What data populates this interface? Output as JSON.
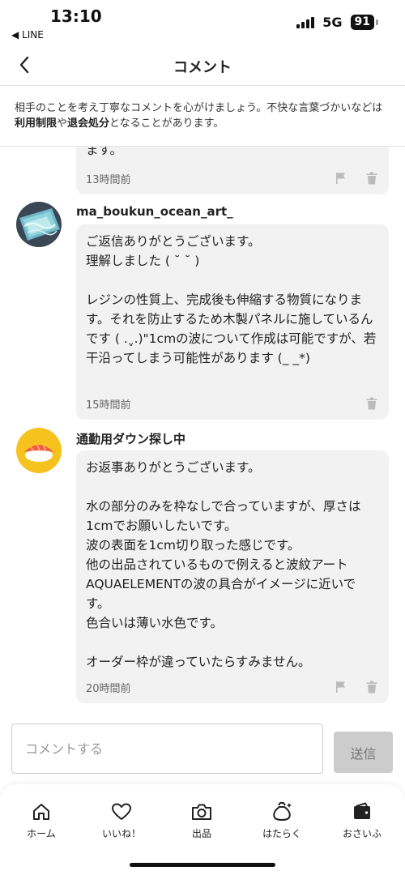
{
  "status_bar": {
    "time": "13:10",
    "back_app": "◀ LINE",
    "network": "5G",
    "battery": "91"
  },
  "header": {
    "title": "コメント",
    "back_icon": "chevron-left-icon"
  },
  "notice": {
    "text_1": "相手のことを考え丁寧なコメントを心がけましょう。不快な言葉づかいなどは",
    "link_1": "利用制限",
    "text_2": "や",
    "link_2": "退会処分",
    "text_3": "となることがあります。"
  },
  "comments": [
    {
      "text": "ます。",
      "time": "13時間前",
      "show_flag": true
    },
    {
      "username": "ma_boukun_ocean_art_",
      "avatar": "ocean-resin-art-avatar",
      "text": "ご返信ありがとうございます。\n理解しました ( ˘ ˘ )\n\nレジンの性質上、完成後も伸縮する物質になります。それを防止するため木製パネルに施しているんです ( .ˬ.)\"1cmの波について作成は可能ですが、若干沿ってしまう可能性があります (_ _*)",
      "time": "15時間前",
      "show_flag": false
    },
    {
      "username": "通勤用ダウン探し中",
      "avatar": "sushi-avatar",
      "text": "お返事ありがとうございます。\n\n水の部分のみを枠なしで合っていますが、厚さは1cmでお願いしたいです。\n波の表面を1cm切り取った感じです。\n他の出品されているもので例えると波紋アートAQUAELEMENTの波の具合がイメージに近いです。\n色合いは薄い水色です。\n\nオーダー枠が違っていたらすみません。",
      "time": "20時間前",
      "show_flag": true
    }
  ],
  "input": {
    "placeholder": "コメントする",
    "send_label": "送信"
  },
  "bottom_nav": [
    {
      "label": "ホーム",
      "icon": "home-icon"
    },
    {
      "label": "いいね！",
      "icon": "heart-icon"
    },
    {
      "label": "出品",
      "icon": "camera-icon"
    },
    {
      "label": "はたらく",
      "icon": "money-bag-icon"
    },
    {
      "label": "おさいふ",
      "icon": "wallet-icon"
    }
  ],
  "colors": {
    "bubble_bg": "#f2f2f2",
    "send_disabled_bg": "#cccccc",
    "border": "#e6e6e6"
  }
}
